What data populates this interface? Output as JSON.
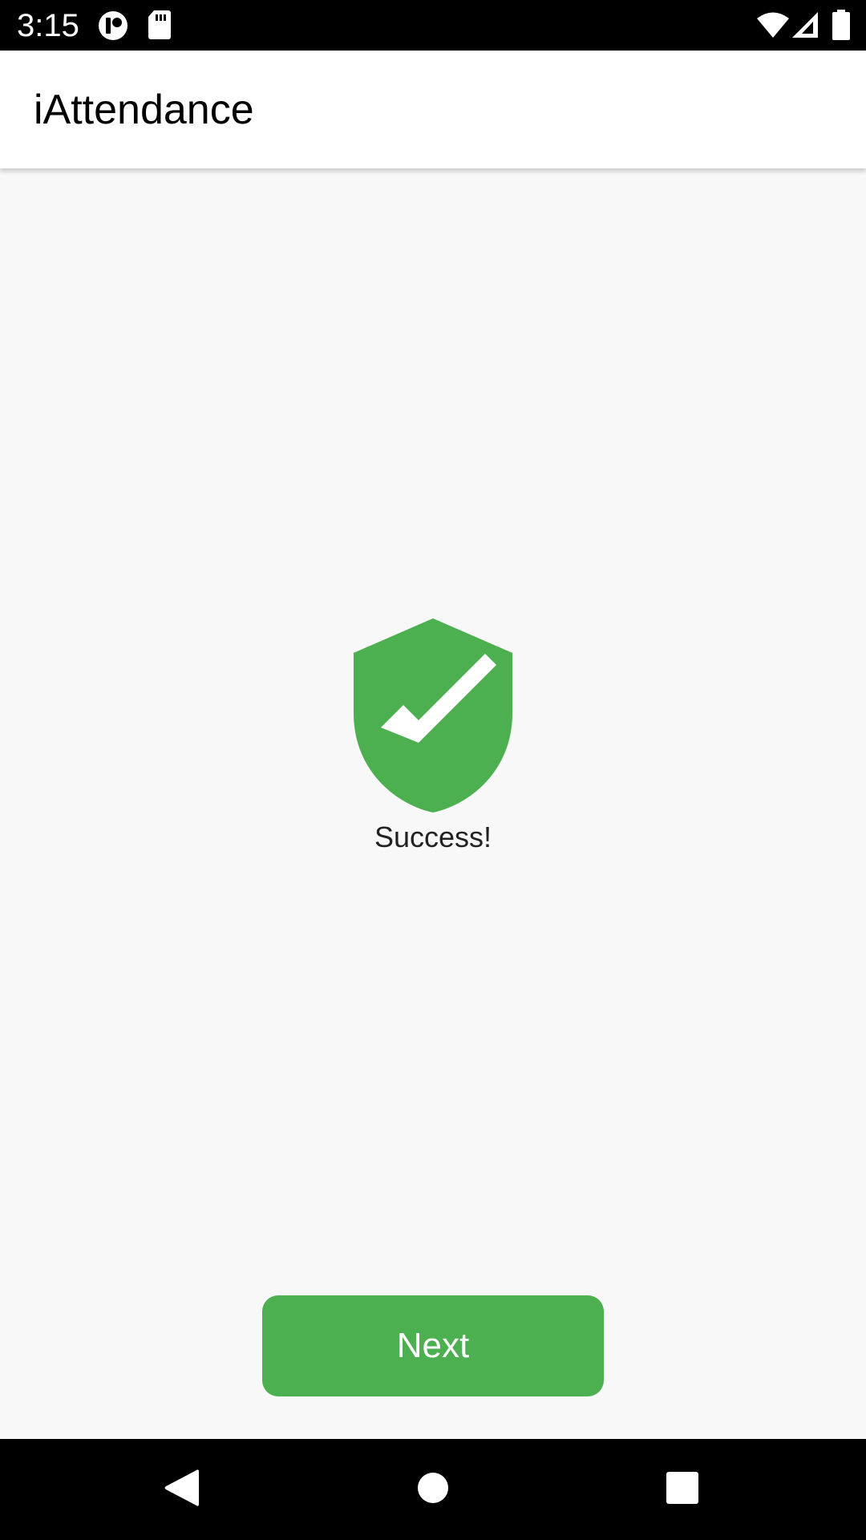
{
  "status_bar": {
    "time": "3:15",
    "icons": [
      "notification-app-icon",
      "sd-card-icon",
      "wifi-icon",
      "cellular-signal-icon",
      "battery-icon"
    ]
  },
  "app_bar": {
    "title": "iAttendance"
  },
  "main": {
    "status_icon": "shield-check-icon",
    "status_text": "Success!",
    "next_label": "Next"
  },
  "nav_bar": {
    "icons": [
      "back-icon",
      "home-icon",
      "recents-icon"
    ]
  },
  "colors": {
    "accent": "#4CAF50",
    "background": "#F8F8F8",
    "app_bar": "#FFFFFF",
    "system_bars": "#000000"
  }
}
